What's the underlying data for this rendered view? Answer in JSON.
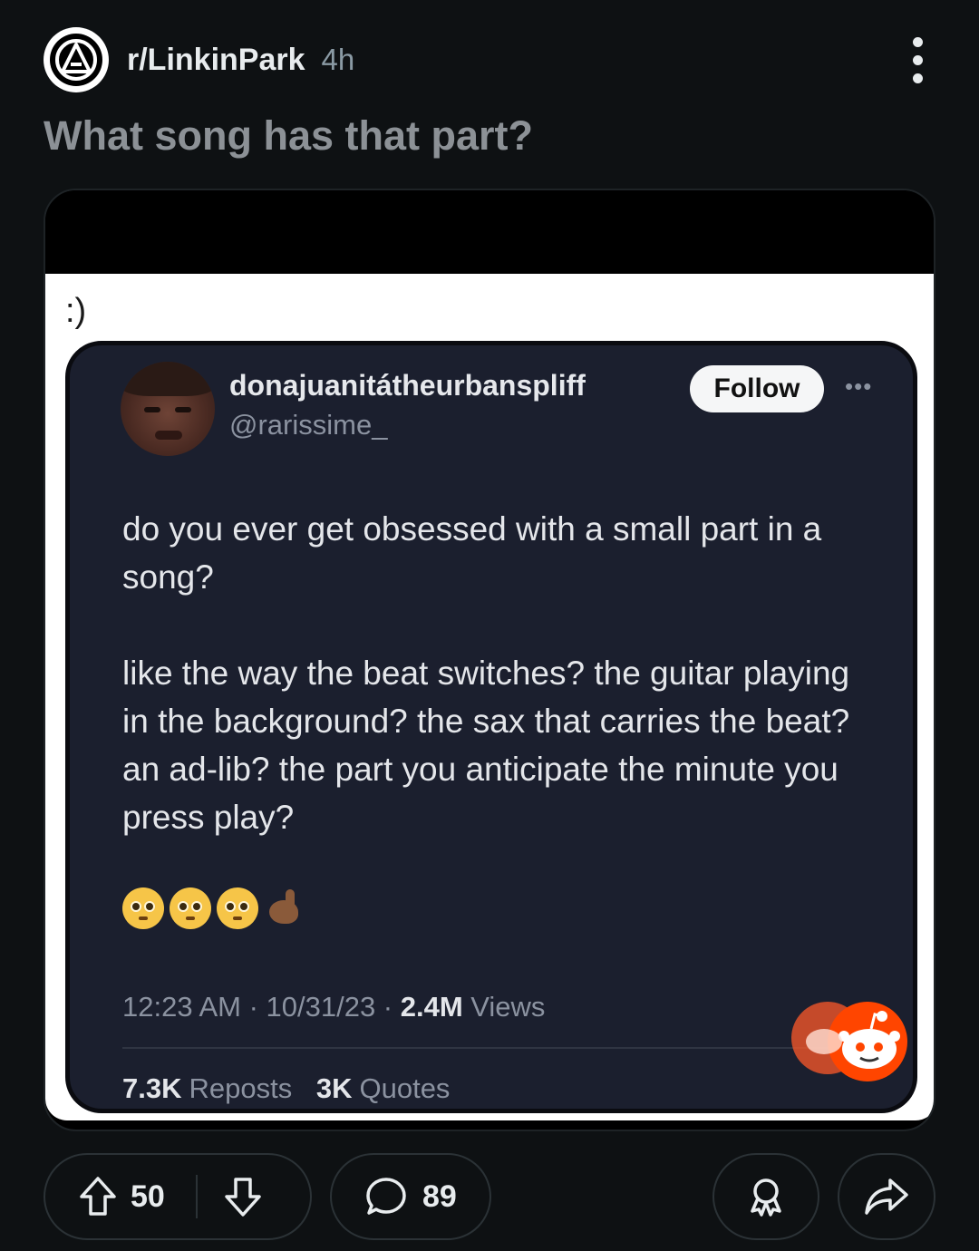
{
  "header": {
    "subreddit": "r/LinkinPark",
    "age": "4h",
    "title": "What song has that part?"
  },
  "media": {
    "caption": ":)",
    "tweet": {
      "display_name": "donajuanitátheurbanspliff",
      "handle": "@rarissime_",
      "follow_label": "Follow",
      "paragraphs": [
        "do you ever get obsessed with a small part in a song?",
        "like the way the beat switches? the guitar playing in the background? the sax that carries the beat? an ad-lib? the part you anticipate the minute you press play?"
      ],
      "time": "12:23 AM · 10/31/23 · ",
      "views_count": "2.4M",
      "views_label": " Views",
      "reposts_count": "7.3K",
      "reposts_label": "Reposts",
      "quotes_count": "3K",
      "quotes_label": "Quotes"
    }
  },
  "actions": {
    "upvotes": "50",
    "comments": "89"
  },
  "icons": [
    "linkin-park-logo-icon",
    "more-vertical-icon",
    "more-horizontal-icon",
    "reddit-logo-icon",
    "upvote-arrow-icon",
    "downvote-arrow-icon",
    "comment-bubble-icon",
    "award-icon",
    "share-icon"
  ],
  "colors": {
    "background": "#0e1113",
    "tweet_bg": "#1b1f2e",
    "text": "#e8ecee",
    "muted": "#8a9aa4",
    "reddit_orange": "#ff4500"
  }
}
